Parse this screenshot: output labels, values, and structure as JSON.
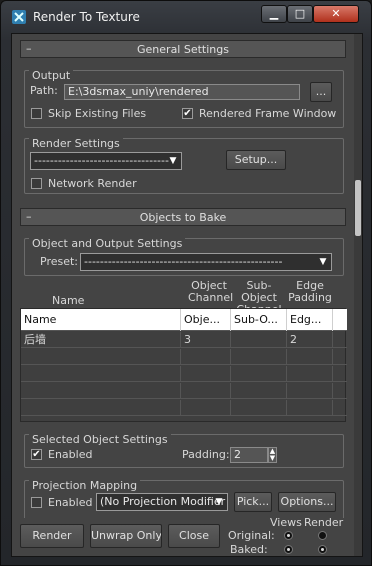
{
  "window": {
    "title": "Render To Texture",
    "min_glyph": "▁",
    "max_glyph": "□",
    "close_glyph": "✕"
  },
  "general": {
    "header": "General Settings",
    "collapse_glyph": "–",
    "output_title": "Output",
    "path_label": "Path:",
    "path_value": "E:\\3dsmax_uniy\\rendered",
    "browse_label": "...",
    "skip_label": "Skip Existing Files",
    "rendered_frame_label": "Rendered Frame Window",
    "render_settings_title": "Render Settings",
    "render_preset_value": "----------------------------------",
    "setup_label": "Setup...",
    "network_label": "Network Render"
  },
  "objects": {
    "header": "Objects to Bake",
    "collapse_glyph": "–",
    "group_title": "Object and Output Settings",
    "preset_label": "Preset:",
    "preset_value": "--------------------------------------------------",
    "columns": {
      "name": "Name",
      "object_channel": "Object\nChannel",
      "sub_object_channel": "Sub-Object\nChannel",
      "edge_padding": "Edge\nPadding"
    },
    "list_header": [
      "Name",
      "Obje...",
      "Sub-O...",
      "Edg..."
    ],
    "rows": [
      [
        "后墙",
        "3",
        "",
        "2"
      ]
    ]
  },
  "selected": {
    "title": "Selected Object Settings",
    "enabled_label": "Enabled",
    "padding_label": "Padding:",
    "padding_value": "2"
  },
  "projection": {
    "title": "Projection Mapping",
    "enabled_label": "Enabled",
    "modifier_value": "(No Projection Modifier",
    "pick_label": "Pick...",
    "options_label": "Options..."
  },
  "footer": {
    "render_label": "Render",
    "unwrap_label": "Unwrap Only",
    "close_label": "Close",
    "views_label": "Views",
    "render_col_label": "Render",
    "original_label": "Original:",
    "baked_label": "Baked:"
  }
}
